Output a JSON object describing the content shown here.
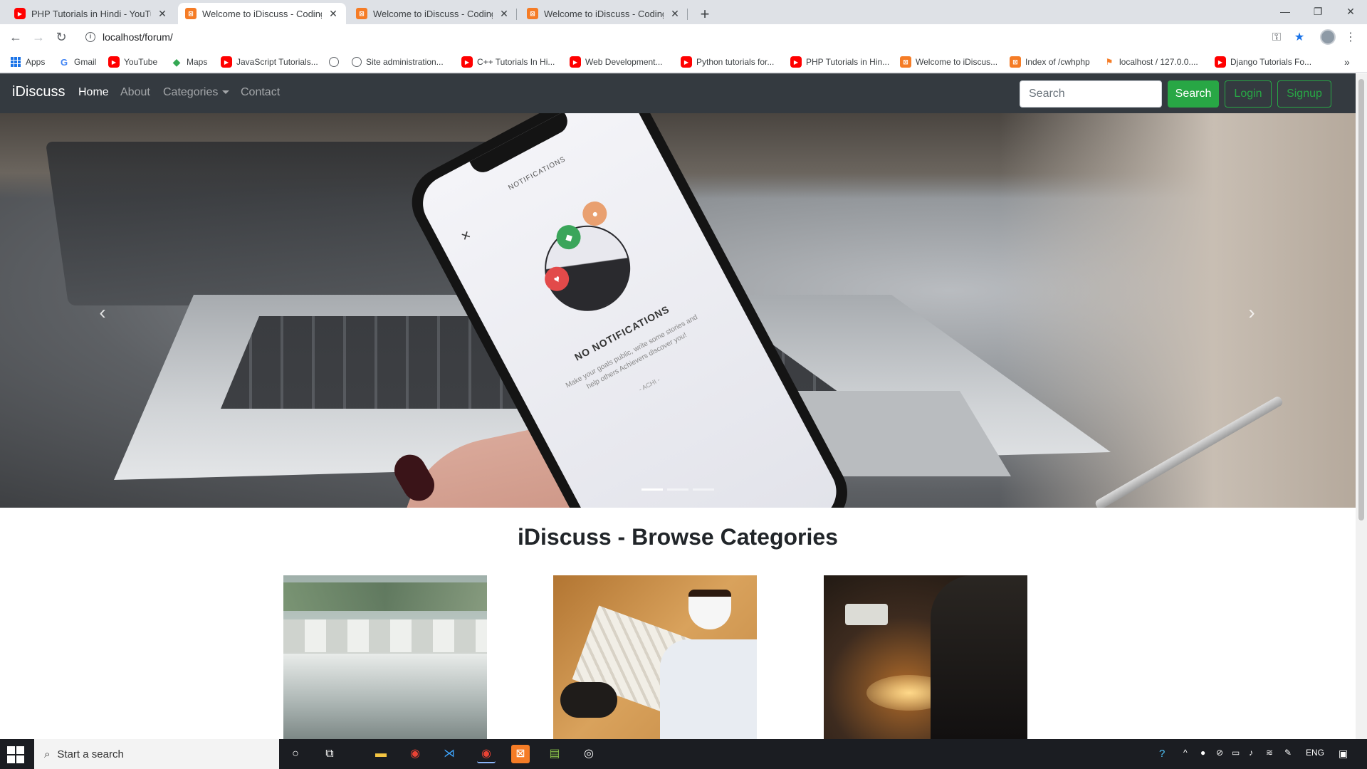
{
  "browser": {
    "tabs": [
      {
        "title": "PHP Tutorials in Hindi - YouTube",
        "icon": "youtube-icon",
        "active": false
      },
      {
        "title": "Welcome to iDiscuss - Coding Fo",
        "icon": "xampp-icon",
        "active": true
      },
      {
        "title": "Welcome to iDiscuss - Coding Fo",
        "icon": "xampp-icon",
        "active": false
      },
      {
        "title": "Welcome to iDiscuss - Coding Fo",
        "icon": "xampp-icon",
        "active": false
      }
    ],
    "address": "localhost/forum/",
    "bookmarks": [
      {
        "label": "Apps",
        "icon": "apps-icon"
      },
      {
        "label": "Gmail",
        "icon": "google-icon"
      },
      {
        "label": "YouTube",
        "icon": "youtube-icon"
      },
      {
        "label": "Maps",
        "icon": "maps-icon"
      },
      {
        "label": "JavaScript Tutorials...",
        "icon": "youtube-icon"
      },
      {
        "label": "",
        "icon": "globe-icon"
      },
      {
        "label": "Site administration...",
        "icon": "globe-icon"
      },
      {
        "label": "C++ Tutorials In Hi...",
        "icon": "youtube-icon"
      },
      {
        "label": "Web Development...",
        "icon": "youtube-icon"
      },
      {
        "label": "Python tutorials for...",
        "icon": "youtube-icon"
      },
      {
        "label": "PHP Tutorials in Hin...",
        "icon": "youtube-icon"
      },
      {
        "label": "Welcome to iDiscus...",
        "icon": "xampp-icon"
      },
      {
        "label": "Index of /cwhphp",
        "icon": "xampp-icon"
      },
      {
        "label": "localhost / 127.0.0....",
        "icon": "phpmyadmin-icon"
      },
      {
        "label": "Django Tutorials Fo...",
        "icon": "youtube-icon"
      }
    ]
  },
  "navbar": {
    "brand": "iDiscuss",
    "links": {
      "home": "Home",
      "about": "About",
      "categories": "Categories",
      "contact": "Contact"
    },
    "search_placeholder": "Search",
    "search_button": "Search",
    "login_button": "Login",
    "signup_button": "Signup",
    "accent_color": "#28a745"
  },
  "carousel": {
    "slide_count": 3,
    "active_index": 0,
    "phone": {
      "title": "NOTIFICATIONS",
      "heading": "NO NOTIFICATIONS",
      "text": "Make your goals public, write some stories and help others Achievers discover you!",
      "sign": "- ACHI -"
    }
  },
  "main": {
    "heading": "iDiscuss - Browse Categories",
    "cards": [
      {
        "image": "water-weir"
      },
      {
        "image": "coffee-magazine"
      },
      {
        "image": "soldering-workbench"
      }
    ]
  },
  "taskbar": {
    "search_placeholder": "Start a search",
    "tray_lang": "ENG"
  }
}
